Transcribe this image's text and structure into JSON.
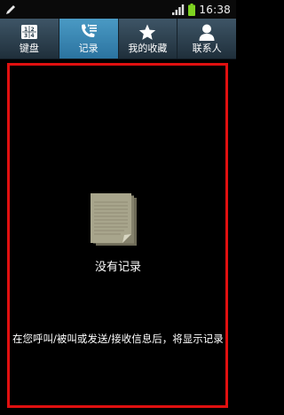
{
  "status_bar": {
    "time": "16:38",
    "left_icon": "pen-icon",
    "signal_icon": "signal-icon",
    "battery_icon": "battery-icon"
  },
  "tabs": [
    {
      "label": "键盘",
      "icon": "keypad-icon",
      "active": false
    },
    {
      "label": "记录",
      "icon": "call-log-icon",
      "active": true
    },
    {
      "label": "我的收藏",
      "icon": "star-icon",
      "active": false
    },
    {
      "label": "联系人",
      "icon": "person-icon",
      "active": false
    }
  ],
  "empty_state": {
    "title": "没有记录",
    "hint": "在您呼叫/被叫或发送/接收信息后，将显示记录",
    "icon": "document-stack-icon"
  },
  "colors": {
    "highlight_border": "#e01010",
    "active_tab": "#3a88b6",
    "tab_bar": "#2e4250",
    "battery": "#7ed321"
  }
}
